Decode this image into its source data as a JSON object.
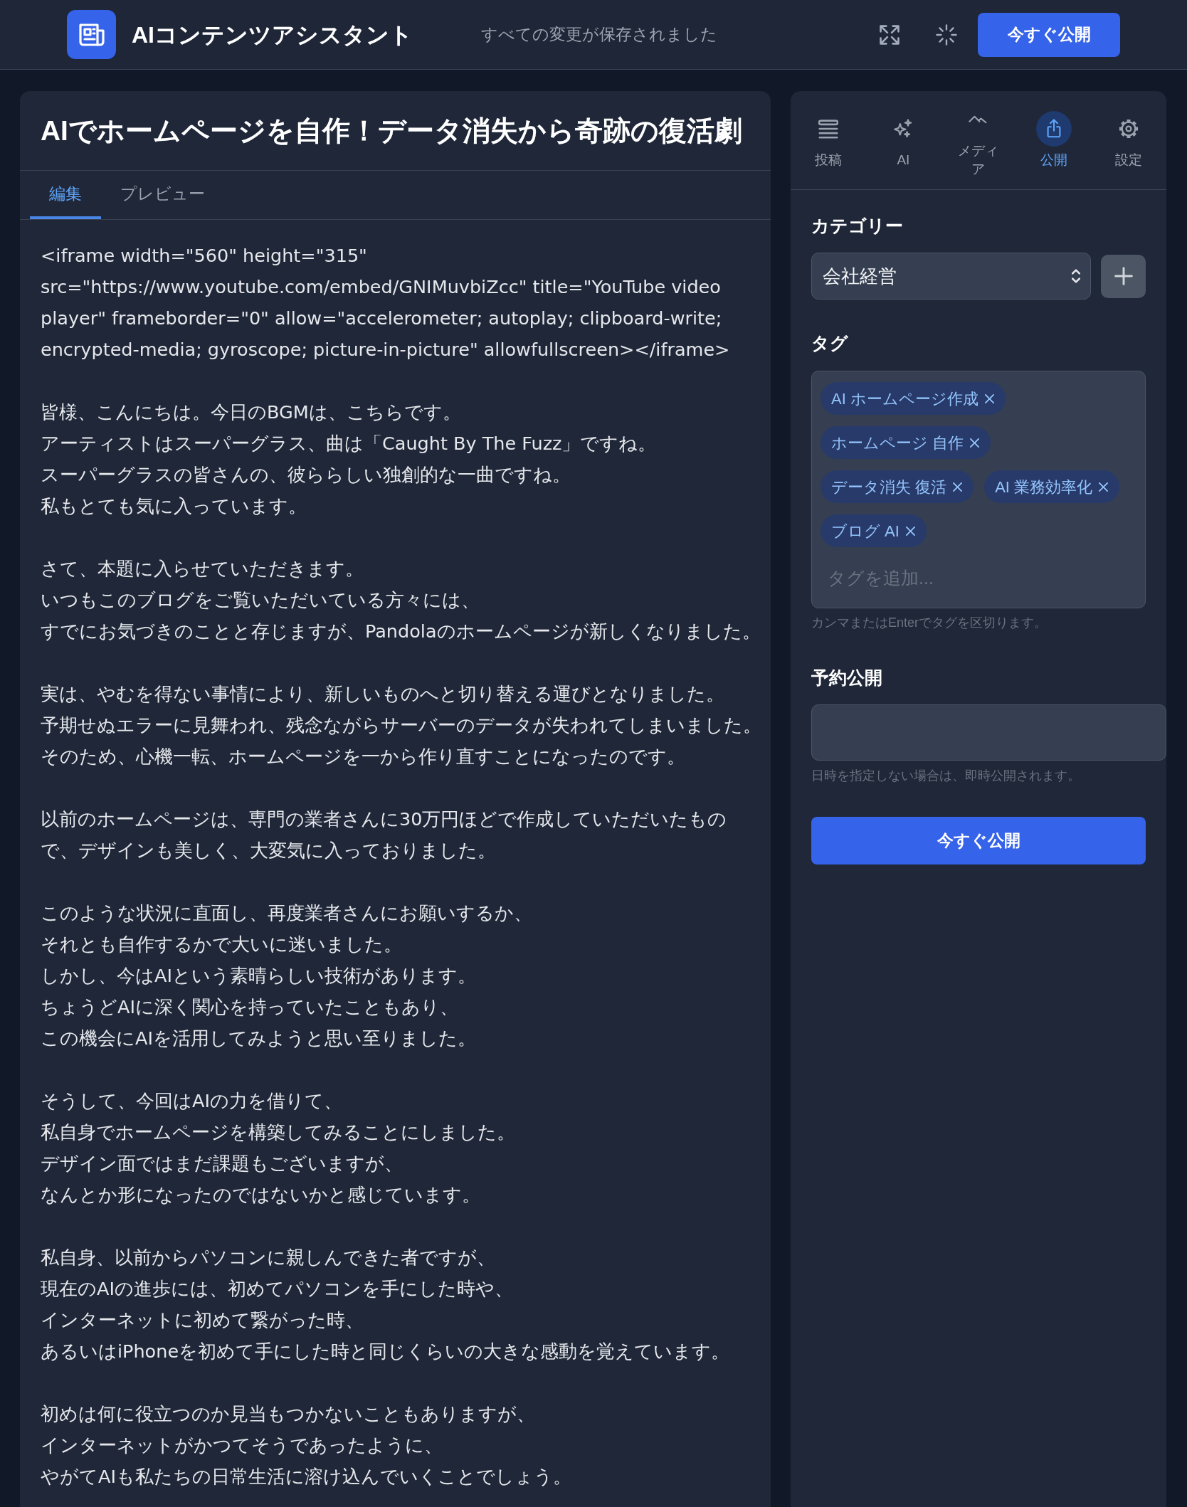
{
  "header": {
    "app_title": "AIコンテンツアシスタント",
    "save_status": "すべての変更が保存されました",
    "publish_button": "今すぐ公開"
  },
  "editor": {
    "title": "AIでホームページを自作！データ消失から奇跡の復活劇",
    "tabs": [
      {
        "label": "編集",
        "selected": true
      },
      {
        "label": "プレビュー",
        "selected": false
      }
    ],
    "paragraphs": [
      [
        "<iframe width=\"560\" height=\"315\"",
        "src=\"https://www.youtube.com/embed/GNIMuvbiZcc\" title=\"YouTube video",
        "player\" frameborder=\"0\" allow=\"accelerometer; autoplay; clipboard-write;",
        "encrypted-media; gyroscope; picture-in-picture\" allowfullscreen></iframe>"
      ],
      [
        "皆様、こんにちは。今日のBGMは、こちらです。",
        "アーティストはスーパーグラス、曲は「Caught By The Fuzz」ですね。",
        "スーパーグラスの皆さんの、彼ららしい独創的な一曲ですね。",
        "私もとても気に入っています。"
      ],
      [
        "さて、本題に入らせていただきます。",
        "いつもこのブログをご覧いただいている方々には、",
        "すでにお気づきのことと存じますが、Pandolaのホームページが新しくなりました。"
      ],
      [
        "実は、やむを得ない事情により、新しいものへと切り替える運びとなりました。",
        "予期せぬエラーに見舞われ、残念ながらサーバーのデータが失われてしまいました。",
        "そのため、心機一転、ホームページを一から作り直すことになったのです。"
      ],
      [
        "以前のホームページは、専門の業者さんに30万円ほどで作成していただいたもの",
        "で、デザインも美しく、大変気に入っておりました。"
      ],
      [
        "このような状況に直面し、再度業者さんにお願いするか、",
        "それとも自作するかで大いに迷いました。",
        "しかし、今はAIという素晴らしい技術があります。",
        "ちょうどAIに深く関心を持っていたこともあり、",
        "この機会にAIを活用してみようと思い至りました。"
      ],
      [
        "そうして、今回はAIの力を借りて、",
        "私自身でホームページを構築してみることにしました。",
        "デザイン面ではまだ課題もございますが、",
        "なんとか形になったのではないかと感じています。"
      ],
      [
        "私自身、以前からパソコンに親しんできた者ですが、",
        "現在のAIの進歩には、初めてパソコンを手にした時や、",
        "インターネットに初めて繋がった時、",
        "あるいはiPhoneを初めて手にした時と同じくらいの大きな感動を覚えています。"
      ],
      [
        "初めは何に役立つのか見当もつかないこともありますが、",
        "インターネットがかつてそうであったように、",
        "やがてAIも私たちの日常生活に溶け込んでいくことでしょう。"
      ]
    ]
  },
  "sidebar": {
    "nav": [
      {
        "label": "投稿",
        "selected": false
      },
      {
        "label": "AI",
        "selected": false
      },
      {
        "label": "メディア",
        "selected": false
      },
      {
        "label": "公開",
        "selected": true
      },
      {
        "label": "設定",
        "selected": false
      }
    ],
    "category": {
      "label": "カテゴリー",
      "value": "会社経営"
    },
    "tags": {
      "label": "タグ",
      "items": [
        "AI ホームページ作成",
        "ホームページ 自作",
        "データ消失 復活",
        "AI 業務効率化",
        "ブログ AI"
      ],
      "placeholder": "タグを追加...",
      "hint": "カンマまたはEnterでタグを区切ります。"
    },
    "schedule": {
      "label": "予約公開",
      "hint": "日時を指定しない場合は、即時公開されます。"
    },
    "publish_button": "今すぐ公開"
  }
}
